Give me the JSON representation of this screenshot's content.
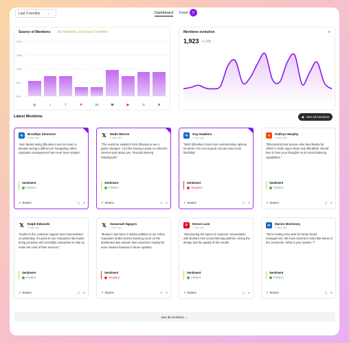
{
  "topbar": {
    "range": "Last 3 months",
    "tabs": [
      {
        "label": "Dashboard"
      },
      {
        "label": "Feed"
      }
    ],
    "feed_count": "0"
  },
  "source": {
    "title": "Source of Mentions",
    "subtitle": "80 mentions, since last 3 months",
    "yticks": [
      "20%",
      "15%",
      "10%",
      "5%",
      "0%"
    ]
  },
  "evolution": {
    "title": "Mentions evolution",
    "value": "1,923",
    "change": "+1.9%"
  },
  "chart_data": [
    {
      "type": "bar",
      "categories": [
        "Instagram",
        "TikTok",
        "Facebook",
        "Pinterest",
        "LinkedIn",
        "Medium",
        "YouTube",
        "Google",
        "X"
      ],
      "values": [
        7,
        9,
        9,
        4,
        4,
        12,
        9,
        11,
        11
      ],
      "ylim": [
        0,
        25
      ],
      "grid": true
    },
    {
      "type": "line",
      "x": [
        0,
        1,
        2,
        3,
        4,
        5,
        6,
        7,
        8,
        9,
        10,
        11,
        12,
        13,
        14,
        15,
        16,
        17,
        18,
        19,
        20
      ],
      "values": [
        22,
        24,
        27,
        23,
        22,
        26,
        55,
        62,
        30,
        38,
        58,
        72,
        35,
        32,
        60,
        70,
        28,
        45,
        60,
        30,
        22
      ],
      "line_color": "#8a16e6"
    }
  ],
  "mentions_section": {
    "title": "Latest Mentions",
    "see_all_top": "See all mentions",
    "see_all_bottom": "See all mentions"
  },
  "mentions": [
    {
      "author": "Brooklyn Simmons",
      "ago": "2 days ago",
      "source": "linkedin",
      "text": "'Just started using @buska.io and our team is already seeing a difference! Navigating online reputation management has never been simpler.",
      "sentiment_label": "Sentiment",
      "sentiment": "Positive",
      "source_label": "Source"
    },
    {
      "author": "Wade Warren",
      "ago": "2 days ago",
      "source": "x",
      "text": "\"The real-time analytics from @buska.io are a game-changer! ;) It's like having a pulse on what the internet says about you. #SocialListening #StartupLife\"",
      "sentiment_label": "Sentiment",
      "sentiment": "Positive",
      "source_label": "Source"
    },
    {
      "author": "Guy Hawkins",
      "ago": "2 days ago",
      "source": "linkedin",
      "text": "\"Wish @buska.io had more customization options for alerts. The tool is great, but we need more flexibility!",
      "sentiment_label": "Sentiment",
      "sentiment": "Negative",
      "source_label": "Source"
    },
    {
      "author": "Kathryn Murphy",
      "ago": "2 days ago",
      "source": "reddit",
      "text": "\"[Discussion] Has anyone else tried Buska for ORM? It looks super sleek and affordable. Would love to hear your thoughts on its social listening capabilities.\"",
      "sentiment_label": "Sentiment",
      "sentiment": "Positive",
      "source_label": "Source"
    },
    {
      "author": "Ralph Edwards",
      "ago": "2 days ago",
      "source": "x",
      "text": "\"Kudos to the customer support team that assisted us yesterday. It's great to see companies like buska being proactive and incredibly responsive to help us make the most of their services.\"",
      "sentiment_label": "Sentiment",
      "sentiment": "Positive",
      "source_label": "Source"
    },
    {
      "author": "Savannah Nguyen",
      "ago": "2 days ago",
      "source": "x",
      "text": "\"Buska.io has been a helpful addition to our online reputation toolkit, but the learning curve on the dashboard was steeper than expected. Hoping for more intuitive features in future updates.",
      "sentiment_label": "Sentiment",
      "sentiment": "Negative",
      "source_label": "Source"
    },
    {
      "author": "Devon Lane",
      "ago": "2 days ago",
      "source": "pinterest",
      "text": "\"Discovering the layers of customer conversation with Buska's new social listening platform, loving the design and the quality of the results.",
      "sentiment_label": "Sentiment",
      "sentiment": "Positive",
      "source_label": "Source"
    },
    {
      "author": "Marvin McKinney",
      "ago": "2 days ago",
      "source": "linkedin",
      "text": "\"We're testing new tools for better brand management. We have several in mind late below in the comments. What is your opinion ?\"",
      "sentiment_label": "Sentiment",
      "sentiment": "Positive",
      "source_label": "Source"
    }
  ],
  "colors": {
    "accent": "#8a16e6",
    "positive": "#4caf50",
    "negative": "#e53935",
    "linkedin": "#0a66c2",
    "x": "#111111",
    "reddit": "#ff4500",
    "pinterest": "#e60023"
  }
}
